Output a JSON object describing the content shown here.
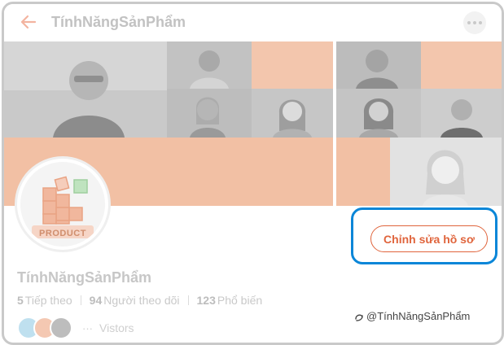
{
  "header": {
    "title": "TínhNăngSảnPhẩm"
  },
  "avatar": {
    "logo_text": "PRODUCT"
  },
  "profile": {
    "edit_button": "Chỉnh sửa hồ sơ",
    "name": "TínhNăngSảnPhẩm",
    "stats": [
      {
        "value": "5",
        "label": "Tiếp theo"
      },
      {
        "value": "94",
        "label": "Người theo dõi"
      },
      {
        "value": "123",
        "label": "Phổ biến"
      }
    ],
    "visitors_dots": "···",
    "visitors_label": "Vistors"
  },
  "watermark": {
    "text": "@TínhNăngSảnPhẩm"
  },
  "colors": {
    "accent": "#e0653d",
    "highlight": "#0a86d8",
    "peach": "#f3c6ad"
  }
}
